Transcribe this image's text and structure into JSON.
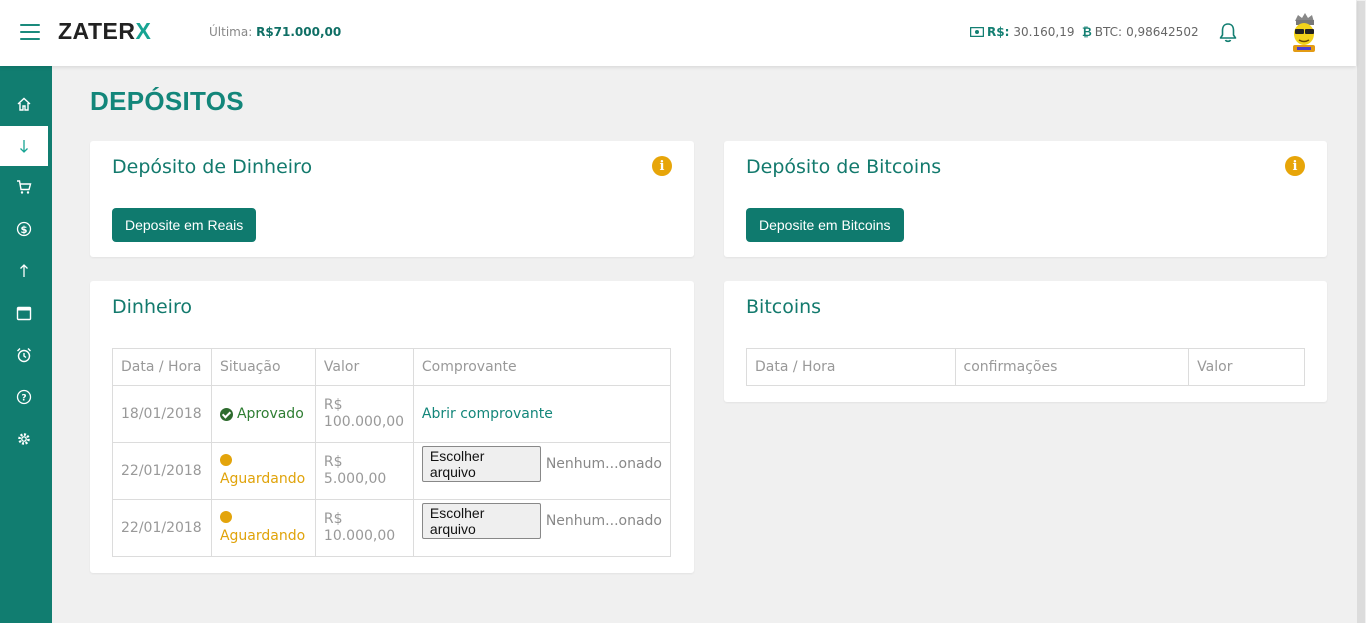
{
  "header": {
    "logo_text": "ZATER",
    "logo_accent": "X",
    "ultima_label": "Última:",
    "ultima_value": "R$71.000,00",
    "brl_label": "R$:",
    "brl_value": "30.160,19",
    "btc_label": "BTC:",
    "btc_value": "0,98642502"
  },
  "sidebar": {
    "items": [
      {
        "icon": "home-icon"
      },
      {
        "icon": "arrow-down-icon",
        "active": true
      },
      {
        "icon": "cart-icon"
      },
      {
        "icon": "dollar-icon"
      },
      {
        "icon": "arrow-up-icon"
      },
      {
        "icon": "calendar-icon"
      },
      {
        "icon": "alarm-clock-icon"
      },
      {
        "icon": "help-icon"
      },
      {
        "icon": "gear-icon"
      }
    ]
  },
  "page": {
    "title": "DEPÓSITOS"
  },
  "deposit_cash": {
    "title": "Depósito de Dinheiro",
    "button": "Deposite em Reais"
  },
  "deposit_btc": {
    "title": "Depósito de Bitcoins",
    "button": "Deposite em Bitcoins"
  },
  "cash_table": {
    "title": "Dinheiro",
    "headers": [
      "Data / Hora",
      "Situação",
      "Valor",
      "Comprovante"
    ],
    "rows": [
      {
        "date": "18/01/2018",
        "status": "Aprovado",
        "status_type": "approved",
        "currency": "R$",
        "amount": "100.000,00",
        "proof_link": "Abrir comprovante"
      },
      {
        "date": "22/01/2018",
        "status": "Aguardando",
        "status_type": "waiting",
        "currency": "R$",
        "amount": "5.000,00",
        "file_button": "Escolher arquivo",
        "file_name": "Nenhum...onado"
      },
      {
        "date": "22/01/2018",
        "status": "Aguardando",
        "status_type": "waiting",
        "currency": "R$",
        "amount": "10.000,00",
        "file_button": "Escolher arquivo",
        "file_name": "Nenhum...onado"
      }
    ]
  },
  "btc_table": {
    "title": "Bitcoins",
    "headers": [
      "Data / Hora",
      "confirmações",
      "Valor"
    ]
  },
  "colors": {
    "primary": "#117d70",
    "accent": "#17a493",
    "warning": "#e3a40b",
    "success": "#2e6b2e"
  }
}
